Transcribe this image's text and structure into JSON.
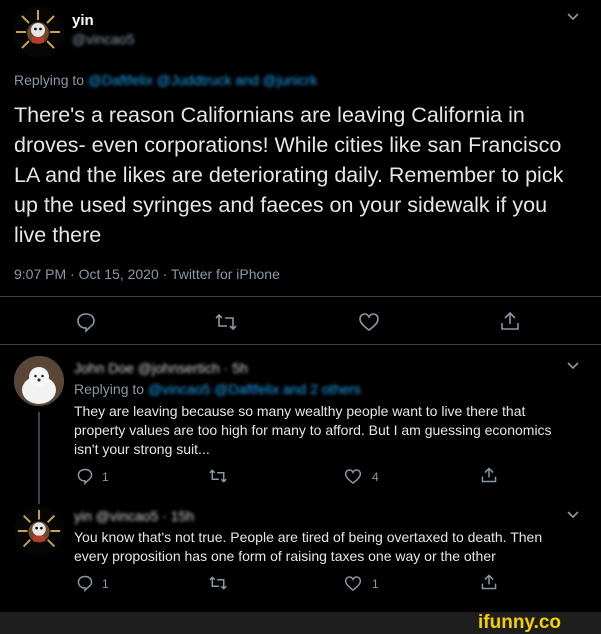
{
  "main_tweet": {
    "display_name": "yin",
    "handle": "@vincao5",
    "replying_label": "Replying to",
    "replying_to": "@Daftfelix @Juddtruck and @junicrk",
    "text": "There's a reason Californians are leaving California in droves- even corporations! While cities like san Francisco LA and the likes are deteriorating daily. Remember to pick up the used syringes and faeces on your sidewalk if you live there",
    "meta": "9:07 PM · Oct 15, 2020 · Twitter for iPhone"
  },
  "reply_1": {
    "header": "John Doe @johnsertich · 5h",
    "replying_label": "Replying to",
    "replying_to": "@vincao5 @Daftfelix and 2 others",
    "text": "They are leaving because so many wealthy people want to live there that property values are too high for many to afford. But I am guessing economics isn't your strong suit...",
    "reply_count": "1",
    "like_count": "4"
  },
  "reply_2": {
    "header": "yin @vincao5 · 15h",
    "text": "You know that's not true. People are tired  of being overtaxed to death. Then every proposition has one form of raising taxes one way or the other",
    "reply_count": "1",
    "like_count": "1"
  },
  "watermark": "ifunny.co",
  "icons": [
    "chevron-down-icon",
    "reply-icon",
    "retweet-icon",
    "like-icon",
    "share-icon"
  ]
}
